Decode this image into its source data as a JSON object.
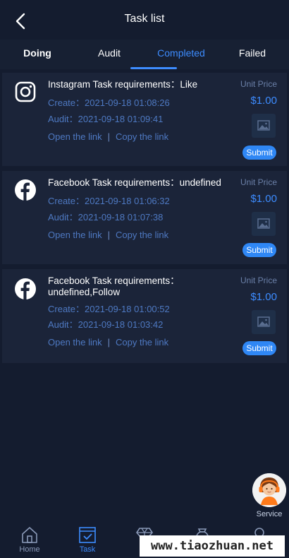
{
  "header": {
    "title": "Task list"
  },
  "tabs": [
    {
      "label": "Doing"
    },
    {
      "label": "Audit"
    },
    {
      "label": "Completed"
    },
    {
      "label": "Failed"
    }
  ],
  "tasks": [
    {
      "platform": "instagram",
      "title": "Instagram Task requirements：Like",
      "create": "Create：2021-09-18 01:08:26",
      "audit": "Audit：2021-09-18 01:09:41",
      "open_link": "Open the link",
      "copy_link": "Copy the link",
      "unit_price_label": "Unit Price",
      "price": "$1.00",
      "submit": "Submit"
    },
    {
      "platform": "facebook",
      "title": "Facebook Task requirements：undefined",
      "create": "Create：2021-09-18 01:06:32",
      "audit": "Audit：2021-09-18 01:07:38",
      "open_link": "Open the link",
      "copy_link": "Copy the link",
      "unit_price_label": "Unit Price",
      "price": "$1.00",
      "submit": "Submit"
    },
    {
      "platform": "facebook",
      "title": "Facebook Task requirements：undefined,Follow",
      "create": "Create：2021-09-18 01:00:52",
      "audit": "Audit：2021-09-18 01:03:42",
      "open_link": "Open the link",
      "copy_link": "Copy the link",
      "unit_price_label": "Unit Price",
      "price": "$1.00",
      "submit": "Submit"
    }
  ],
  "service": {
    "label": "Service"
  },
  "nav": [
    {
      "label": "Home",
      "icon": "home-icon"
    },
    {
      "label": "Task",
      "icon": "task-icon"
    },
    {
      "label": "",
      "icon": "diamond-icon"
    },
    {
      "label": "",
      "icon": "wallet-icon"
    },
    {
      "label": "",
      "icon": "user-icon"
    }
  ],
  "watermark": "www.tiaozhuan.net",
  "colors": {
    "background": "#141c2f",
    "card": "#1b2439",
    "accent": "#3d8cff",
    "link": "#4e79c2"
  }
}
